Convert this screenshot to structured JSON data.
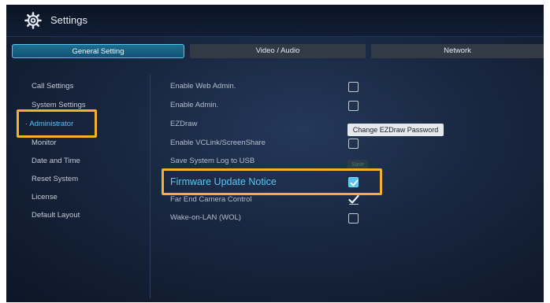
{
  "window": {
    "title": "Settings",
    "title_icon": "gear-icon"
  },
  "tabs": [
    {
      "label": "General Setting",
      "active": true
    },
    {
      "label": "Video / Audio",
      "active": false
    },
    {
      "label": "Network",
      "active": false
    }
  ],
  "sidebar": {
    "items": [
      {
        "label": "Call Settings",
        "active": false
      },
      {
        "label": "System Settings",
        "active": false
      },
      {
        "label": "· Administrator",
        "active": true
      },
      {
        "label": "Monitor",
        "active": false
      },
      {
        "label": "Date and Time",
        "active": false
      },
      {
        "label": "Reset System",
        "active": false
      },
      {
        "label": "License",
        "active": false
      },
      {
        "label": "Default Layout",
        "active": false
      }
    ]
  },
  "settings": {
    "rows": [
      {
        "label": "Enable Web Admin.",
        "control": "checkbox",
        "checked": false
      },
      {
        "label": "Enable Admin.",
        "control": "checkbox",
        "checked": false
      },
      {
        "label": "EZDraw",
        "control": "button",
        "button_label": "Change EZDraw Password"
      },
      {
        "label": "Enable VCLink/ScreenShare",
        "control": "checkbox",
        "checked": false
      },
      {
        "label": "Save System Log to USB",
        "control": "button",
        "button_label": "Save",
        "disabled": true
      },
      {
        "label": "Firmware Update Notice",
        "control": "checkbox",
        "checked": true,
        "highlighted": true
      },
      {
        "label": "Far End Camera Control",
        "control": "checkbox",
        "checked": true
      },
      {
        "label": "Wake-on-LAN (WOL)",
        "control": "checkbox",
        "checked": false
      }
    ]
  },
  "colors": {
    "accent": "#4cc6ff",
    "highlight_box": "#f5b12c",
    "background": "#18263f"
  }
}
